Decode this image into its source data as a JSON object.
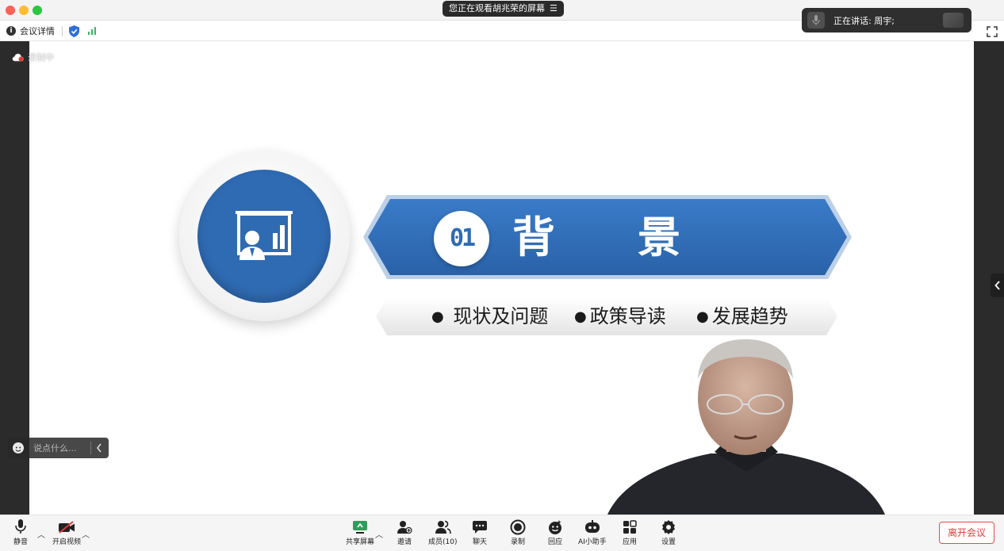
{
  "window": {
    "sharing_label": "您正在观看胡兆荣的屏幕",
    "sharing_icon": "list-menu-icon",
    "traffic_colors": [
      "#fe5f57",
      "#febc2e",
      "#28c840"
    ]
  },
  "infobar": {
    "meeting_details": "会议详情",
    "security_icon": "shield-check-icon",
    "signal_icon": "signal-bars-icon"
  },
  "speaking": {
    "label": "正在讲话:  周宇;"
  },
  "recording": {
    "label": "录制中"
  },
  "chat": {
    "placeholder": "说点什么..."
  },
  "slide": {
    "number": "01",
    "title_char_1": "背",
    "title_char_2": "景",
    "topics": [
      "现状及问题",
      "政策导读",
      "发展趋势"
    ],
    "accent_color": "#2f6bb3"
  },
  "toolbar": {
    "mute": "静音",
    "video": "开启视频",
    "share": "共享屏幕",
    "invite": "邀请",
    "members": "成员(10)",
    "chat": "聊天",
    "record": "录制",
    "react": "回应",
    "ai": "AI小助手",
    "apps": "应用",
    "settings": "设置",
    "leave": "离开会议"
  }
}
